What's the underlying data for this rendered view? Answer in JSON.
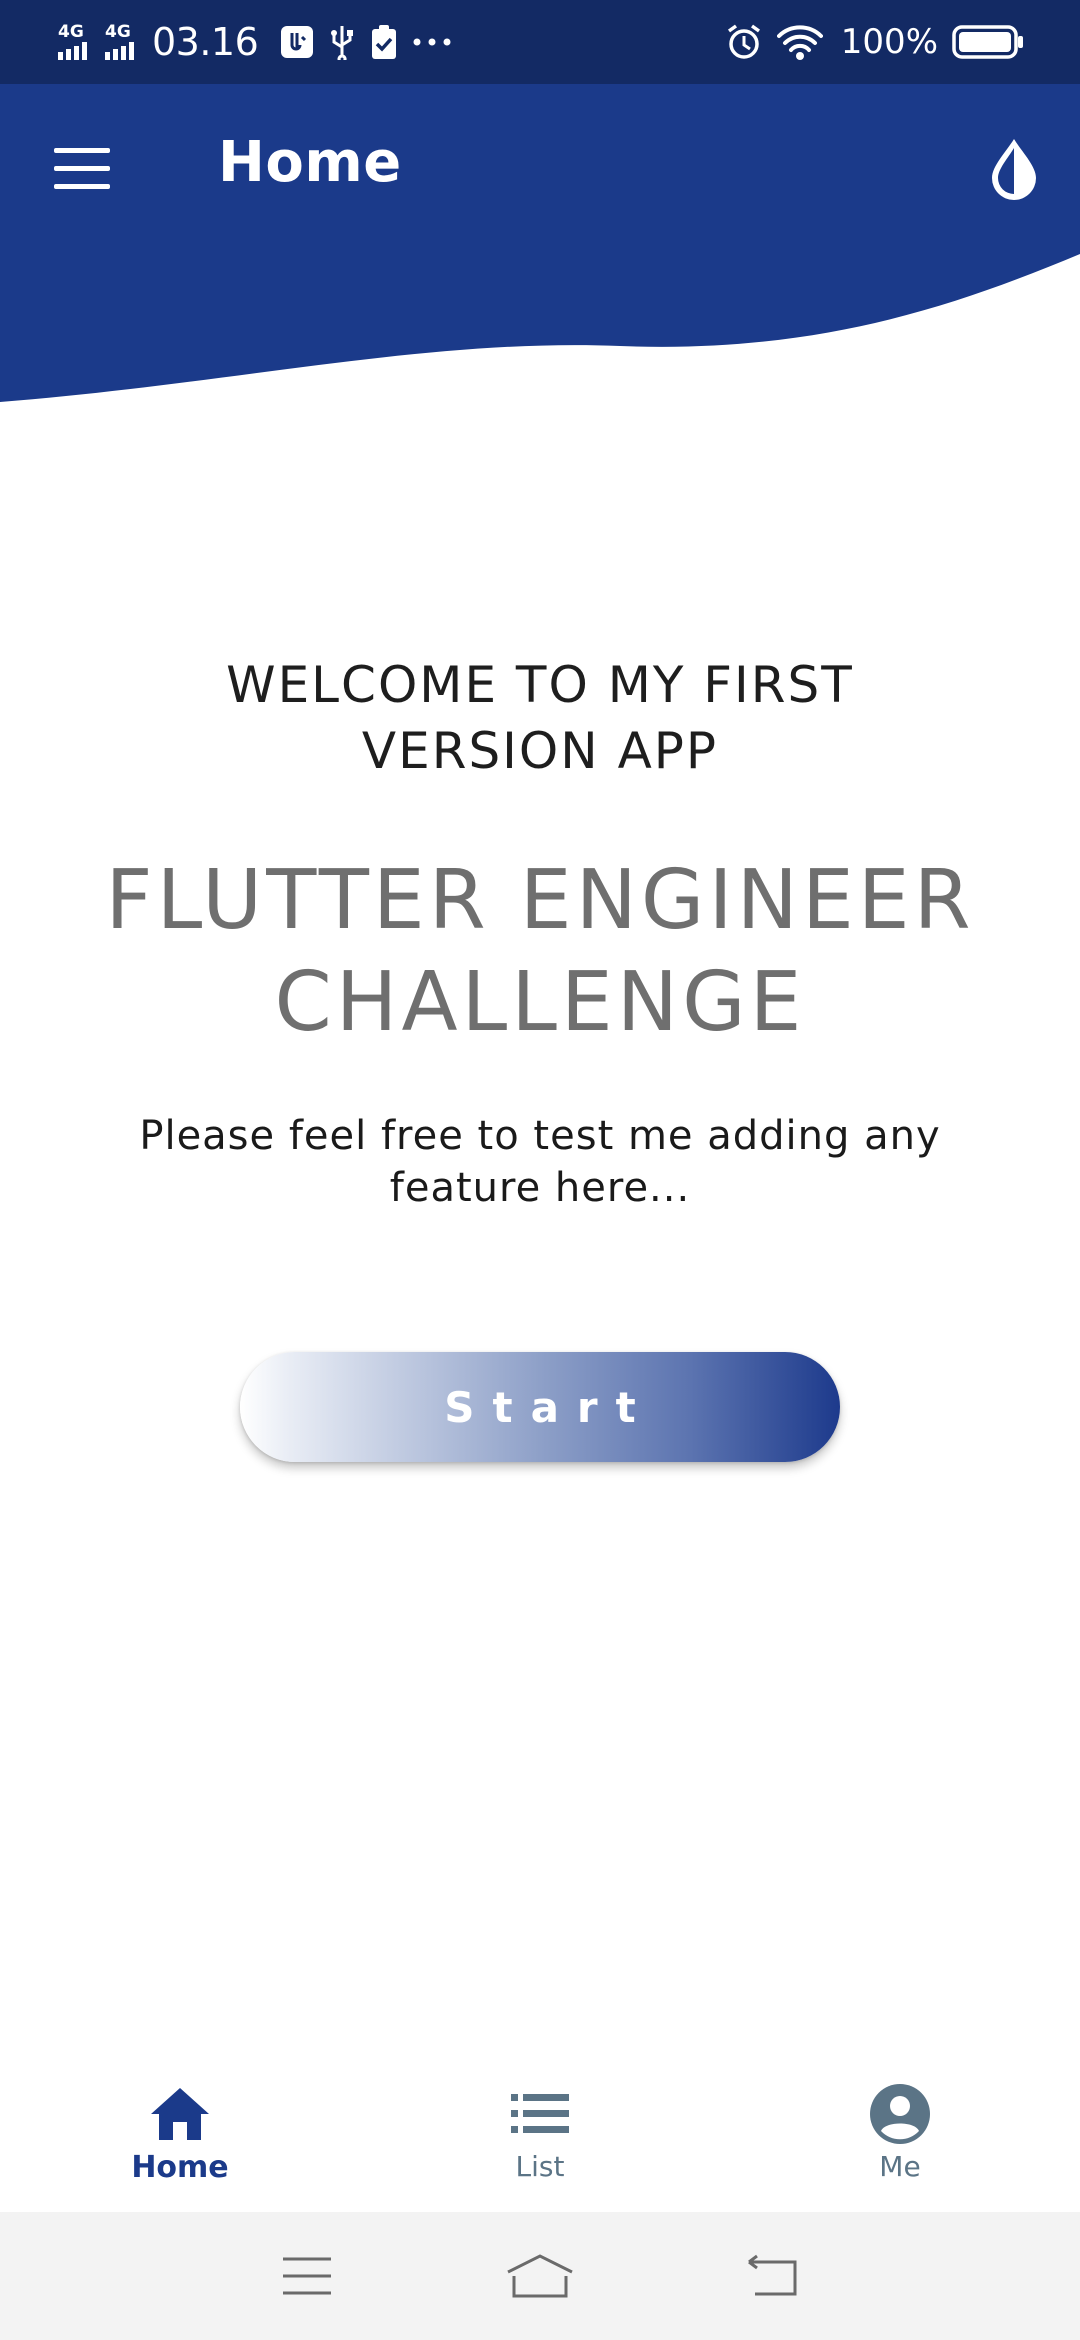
{
  "status_bar": {
    "network_1": "4G",
    "network_2": "4G",
    "time": "03.16",
    "battery": "100%",
    "icons": [
      "signal-icon",
      "signal-icon",
      "usb-debug-icon",
      "usb-icon",
      "clipboard-check-icon",
      "more-dots-icon",
      "alarm-icon",
      "wifi-icon",
      "battery-icon"
    ]
  },
  "header": {
    "title": "Home",
    "menu_icon": "hamburger-menu-icon",
    "theme_icon": "water-drop-icon",
    "color": "#1b3a8a"
  },
  "main": {
    "welcome": "WELCOME TO MY FIRST VERSION APP",
    "headline": "FLUTTER ENGINEER CHALLENGE",
    "subtitle": "Please feel free to test me adding any feature here...",
    "start_label": "Start"
  },
  "bottom_nav": {
    "items": [
      {
        "label": "Home",
        "icon": "home-icon",
        "active": true
      },
      {
        "label": "List",
        "icon": "list-icon",
        "active": false
      },
      {
        "label": "Me",
        "icon": "account-circle-icon",
        "active": false
      }
    ],
    "active_color": "#1b3a8a",
    "inactive_color": "#5b7486"
  },
  "system_nav": {
    "icons": [
      "recent-apps-icon",
      "home-outline-icon",
      "back-icon"
    ]
  }
}
